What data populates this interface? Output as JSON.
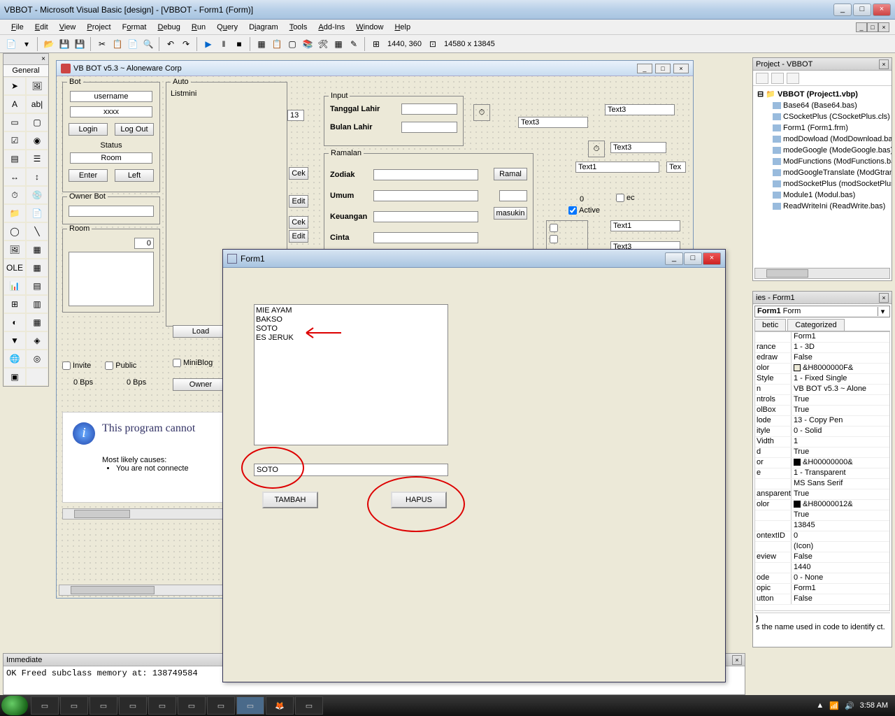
{
  "titlebar": {
    "title": "VBBOT - Microsoft Visual Basic [design] - [VBBOT - Form1 (Form)]"
  },
  "menubar": {
    "items": [
      "File",
      "Edit",
      "View",
      "Project",
      "Format",
      "Debug",
      "Run",
      "Query",
      "Diagram",
      "Tools",
      "Add-Ins",
      "Window",
      "Help"
    ]
  },
  "toolbar_status": {
    "pos": "1440, 360",
    "size": "14580 x 13845"
  },
  "toolbox": {
    "tab": "General"
  },
  "mdichild": {
    "title": "VB BOT v5.3 ~ Aloneware Corp",
    "bot": {
      "title": "Bot",
      "username": "username",
      "password": "xxxx",
      "login": "Login",
      "logout": "Log Out",
      "status_label": "Status",
      "room_label": "Room",
      "enter": "Enter",
      "left": "Left"
    },
    "owner_bot": "Owner Bot",
    "room": "Room",
    "room_count": "0",
    "auto": {
      "title": "Auto",
      "listmini": "Listmini"
    },
    "thirteen": "13",
    "input": {
      "title": "Input",
      "tgl": "Tanggal Lahir",
      "bln": "Bulan Lahir"
    },
    "ramalan": {
      "title": "Ramalan",
      "zodiak": "Zodiak",
      "umum": "Umum",
      "keuangan": "Keuangan",
      "cinta": "Cinta",
      "ramal": "Ramal",
      "masukin": "masukin"
    },
    "cek": "Cek",
    "edit": "Edit",
    "text3": "Text3",
    "text1": "Text1",
    "tex": "Tex",
    "zero": "0",
    "ec": "ec",
    "active": "Active",
    "load": "Load",
    "miniblog": "MiniBlog",
    "owner": "Owner",
    "invite": "Invite",
    "public": "Public",
    "bps": "0 Bps",
    "info_msg": "This program cannot",
    "causes": "Most likely causes:",
    "cause1": "You are not connecte"
  },
  "form1": {
    "title": "Form1",
    "list": [
      "MIE AYAM",
      "BAKSO",
      "SOTO",
      "ES JERUK"
    ],
    "input_value": "SOTO",
    "tambah": "TAMBAH",
    "hapus": "HAPUS"
  },
  "project": {
    "title": "Project - VBBOT",
    "root": "VBBOT (Project1.vbp)",
    "items": [
      "Base64 (Base64.bas)",
      "CSocketPlus (CSocketPlus.cls)",
      "Form1 (Form1.frm)",
      "modDowload (ModDownload.bas",
      "modeGoogle (ModeGoogle.bas)",
      "ModFunctions (ModFunctions.ba",
      "modGoogleTranslate (ModGtrans",
      "modSocketPlus (modSocketPlus.b",
      "Module1 (Modul.bas)",
      "ReadWriteIni (ReadWrite.bas)"
    ]
  },
  "properties": {
    "title": "ies - Form1",
    "object": "Form1 Form",
    "tabs": [
      "betic",
      "Categorized"
    ],
    "rows": [
      {
        "k": "",
        "v": "Form1"
      },
      {
        "k": "rance",
        "v": "1 - 3D"
      },
      {
        "k": "edraw",
        "v": "False"
      },
      {
        "k": "olor",
        "v": "&H8000000F&",
        "swatch": "#ece9d8"
      },
      {
        "k": "Style",
        "v": "1 - Fixed Single"
      },
      {
        "k": "n",
        "v": "VB BOT v5.3 ~ Alone"
      },
      {
        "k": "ntrols",
        "v": "True"
      },
      {
        "k": "olBox",
        "v": "True"
      },
      {
        "k": "lode",
        "v": "13 - Copy Pen"
      },
      {
        "k": "ityle",
        "v": "0 - Solid"
      },
      {
        "k": "Vidth",
        "v": "1"
      },
      {
        "k": "d",
        "v": "True"
      },
      {
        "k": "or",
        "v": "&H00000000&",
        "swatch": "#000"
      },
      {
        "k": "e",
        "v": "1 - Transparent"
      },
      {
        "k": "",
        "v": "MS Sans Serif"
      },
      {
        "k": "ansparent",
        "v": "True"
      },
      {
        "k": "olor",
        "v": "&H80000012&",
        "swatch": "#000"
      },
      {
        "k": "",
        "v": "True"
      },
      {
        "k": "",
        "v": "13845"
      },
      {
        "k": "ontextID",
        "v": "0"
      },
      {
        "k": "",
        "v": "(Icon)"
      },
      {
        "k": "eview",
        "v": "False"
      },
      {
        "k": "",
        "v": "1440"
      },
      {
        "k": "ode",
        "v": "0 - None"
      },
      {
        "k": "opic",
        "v": "Form1"
      },
      {
        "k": "utton",
        "v": "False"
      }
    ],
    "desc_title": ")",
    "desc": "s the name used in code to identify ct."
  },
  "immediate": {
    "title": "Immediate",
    "line": "OK Freed subclass memory at: 138749584"
  },
  "tray": {
    "time": "3:58 AM"
  }
}
